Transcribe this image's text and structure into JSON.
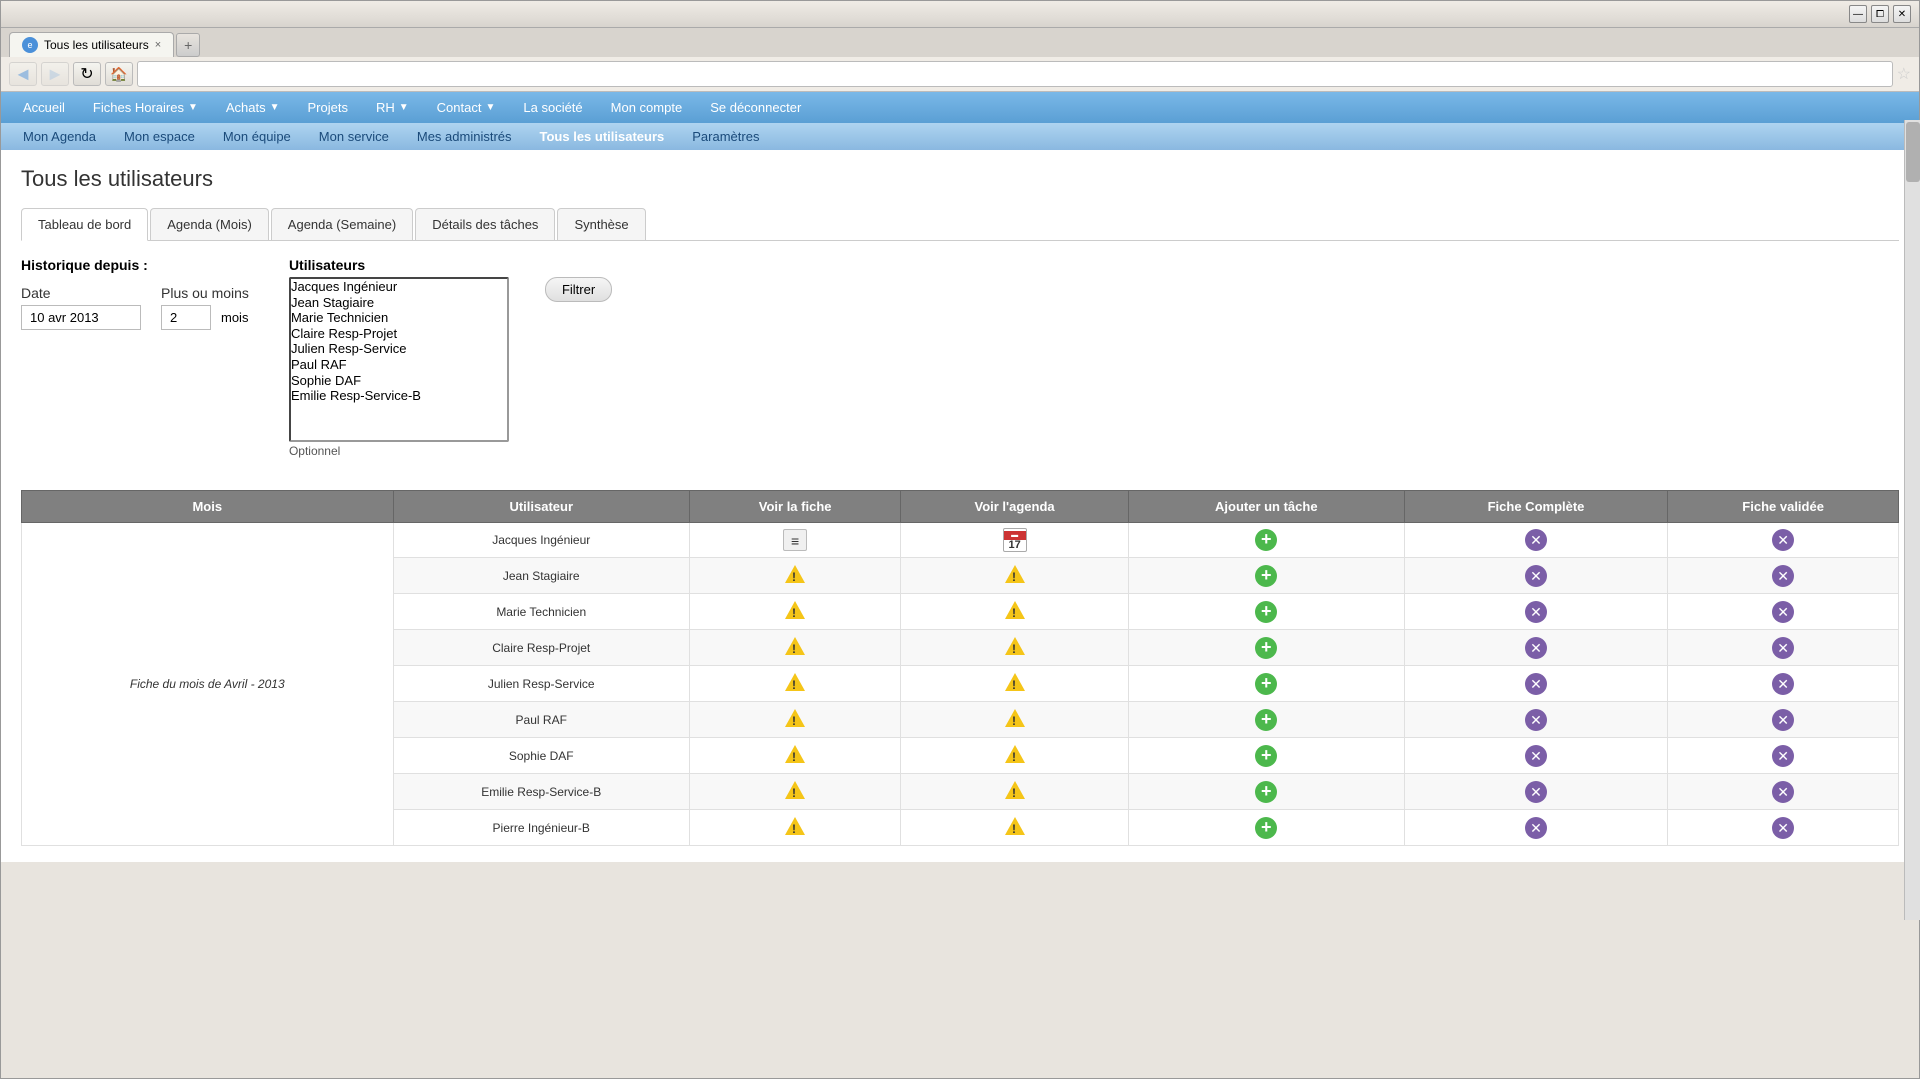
{
  "browser": {
    "tab_label": "Tous les utilisateurs",
    "tab_close": "×",
    "new_tab": "+",
    "nav_back": "◄",
    "nav_forward": "►",
    "nav_reload": "↺",
    "nav_home": "⌂",
    "star": "☆",
    "address": ""
  },
  "top_nav": {
    "items": [
      {
        "id": "accueil",
        "label": "Accueil",
        "has_arrow": false
      },
      {
        "id": "fiches-horaires",
        "label": "Fiches Horaires",
        "has_arrow": true
      },
      {
        "id": "achats",
        "label": "Achats",
        "has_arrow": true
      },
      {
        "id": "projets",
        "label": "Projets",
        "has_arrow": false
      },
      {
        "id": "rh",
        "label": "RH",
        "has_arrow": true
      },
      {
        "id": "contact",
        "label": "Contact",
        "has_arrow": true
      },
      {
        "id": "la-societe",
        "label": "La société",
        "has_arrow": false
      },
      {
        "id": "mon-compte",
        "label": "Mon compte",
        "has_arrow": false
      },
      {
        "id": "se-deconnecter",
        "label": "Se déconnecter",
        "has_arrow": false
      }
    ]
  },
  "sub_nav": {
    "items": [
      {
        "id": "mon-agenda",
        "label": "Mon Agenda"
      },
      {
        "id": "mon-espace",
        "label": "Mon espace"
      },
      {
        "id": "mon-equipe",
        "label": "Mon équipe"
      },
      {
        "id": "mon-service",
        "label": "Mon service"
      },
      {
        "id": "mes-administres",
        "label": "Mes administrés"
      },
      {
        "id": "tous-les-utilisateurs",
        "label": "Tous les utilisateurs",
        "active": true
      },
      {
        "id": "parametres",
        "label": "Paramètres"
      }
    ]
  },
  "page": {
    "title": "Tous les utilisateurs",
    "tabs": [
      {
        "id": "tableau-de-bord",
        "label": "Tableau de bord",
        "active": true
      },
      {
        "id": "agenda-mois",
        "label": "Agenda (Mois)"
      },
      {
        "id": "agenda-semaine",
        "label": "Agenda (Semaine)"
      },
      {
        "id": "details-taches",
        "label": "Détails des tâches"
      },
      {
        "id": "synthese",
        "label": "Synthèse"
      }
    ]
  },
  "filters": {
    "historique_label": "Historique depuis :",
    "date_label": "Date",
    "date_value": "10 avr 2013",
    "plus_moins_label": "Plus ou moins",
    "plus_moins_value": "2",
    "mois_label": "mois",
    "utilisateurs_label": "Utilisateurs",
    "filter_btn": "Filtrer",
    "optionnel": "Optionnel",
    "users": [
      "Jacques Ingénieur",
      "Jean Stagiaire",
      "Marie Technicien",
      "Claire Resp-Projet",
      "Julien Resp-Service",
      "Paul RAF",
      "Sophie DAF",
      "Emilie Resp-Service-B"
    ]
  },
  "table": {
    "headers": [
      {
        "id": "mois",
        "label": "Mois"
      },
      {
        "id": "utilisateur",
        "label": "Utilisateur"
      },
      {
        "id": "voir-fiche",
        "label": "Voir la fiche"
      },
      {
        "id": "voir-agenda",
        "label": "Voir l'agenda"
      },
      {
        "id": "ajouter-tache",
        "label": "Ajouter un tâche"
      },
      {
        "id": "fiche-complete",
        "label": "Fiche Complète"
      },
      {
        "id": "fiche-validee",
        "label": "Fiche validée"
      }
    ],
    "month_group": "Fiche du mois de Avril - 2013",
    "rows": [
      {
        "user": "Jacques Ingénieur",
        "voir_fiche": "list",
        "voir_agenda": "calendar",
        "ajouter_tache": "add",
        "fiche_complete": "blocked",
        "fiche_validee": "blocked"
      },
      {
        "user": "Jean Stagiaire",
        "voir_fiche": "warning",
        "voir_agenda": "warning",
        "ajouter_tache": "add",
        "fiche_complete": "blocked",
        "fiche_validee": "blocked"
      },
      {
        "user": "Marie Technicien",
        "voir_fiche": "warning",
        "voir_agenda": "warning",
        "ajouter_tache": "add",
        "fiche_complete": "blocked",
        "fiche_validee": "blocked"
      },
      {
        "user": "Claire Resp-Projet",
        "voir_fiche": "warning",
        "voir_agenda": "warning",
        "ajouter_tache": "add",
        "fiche_complete": "blocked",
        "fiche_validee": "blocked"
      },
      {
        "user": "Julien Resp-Service",
        "voir_fiche": "warning",
        "voir_agenda": "warning",
        "ajouter_tache": "add",
        "fiche_complete": "blocked",
        "fiche_validee": "blocked"
      },
      {
        "user": "Paul RAF",
        "voir_fiche": "warning",
        "voir_agenda": "warning",
        "ajouter_tache": "add",
        "fiche_complete": "blocked",
        "fiche_validee": "blocked"
      },
      {
        "user": "Sophie DAF",
        "voir_fiche": "warning",
        "voir_agenda": "warning",
        "ajouter_tache": "add",
        "fiche_complete": "blocked",
        "fiche_validee": "blocked"
      },
      {
        "user": "Emilie Resp-Service-B",
        "voir_fiche": "warning",
        "voir_agenda": "warning",
        "ajouter_tache": "add",
        "fiche_complete": "blocked",
        "fiche_validee": "blocked"
      },
      {
        "user": "Pierre Ingénieur-B",
        "voir_fiche": "warning",
        "voir_agenda": "warning",
        "ajouter_tache": "add",
        "fiche_complete": "blocked",
        "fiche_validee": "blocked"
      }
    ]
  }
}
